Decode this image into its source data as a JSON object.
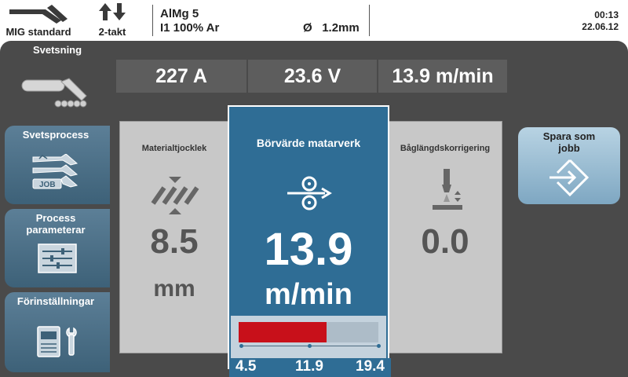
{
  "status": {
    "process_label": "MIG standard",
    "trigger_label": "2-takt",
    "material": "AlMg 5",
    "gas": "I1 100% Ar",
    "wire_symbol": "Ø",
    "wire_diameter": "1.2mm",
    "time": "00:13",
    "date": "22.06.12"
  },
  "welding": {
    "title": "Svetsning",
    "current": "227 A",
    "voltage": "23.6 V",
    "wire_speed": "13.9 m/min"
  },
  "nav": {
    "process": "Svetsprocess",
    "params_line1": "Process",
    "params_line2": "parameterar",
    "presets": "Förinställningar",
    "job_tag": "JOB"
  },
  "panels": {
    "thickness": {
      "title": "Materialtjocklek",
      "value": "8.5",
      "unit": "mm"
    },
    "setpoint": {
      "title": "Börvärde matarverk",
      "value": "13.9",
      "unit": "m/min",
      "min": "4.5",
      "mid": "11.9",
      "max": "19.4",
      "level_fraction": 0.63
    },
    "arc_length": {
      "title": "Båglängdskorrigering",
      "value": "0.0"
    }
  },
  "save": {
    "line1": "Spara som",
    "line2": "jobb"
  },
  "colors": {
    "accent_blue": "#2f6d95",
    "bar_red": "#c8101a",
    "frame": "#4a4a4a"
  }
}
